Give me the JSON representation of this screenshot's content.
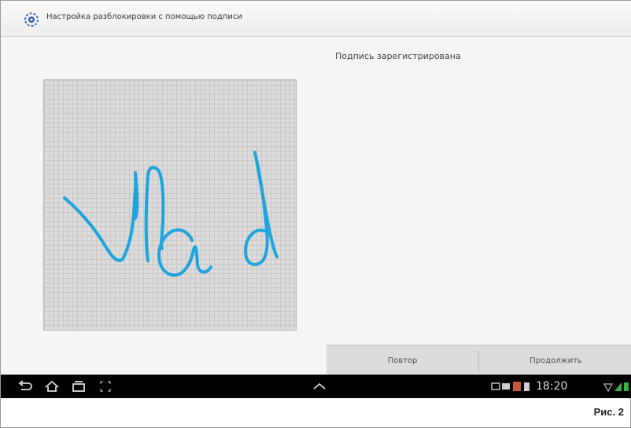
{
  "window": {
    "title": "Настройка разблокировки с помощью подписи",
    "app_icon": "gear-eye-icon"
  },
  "main": {
    "status_message": "Подпись зарегистрирована",
    "signature_handwriting": "Vlad"
  },
  "buttons": {
    "retry_label": "Повтор",
    "continue_label": "Продолжить"
  },
  "navbar": {
    "icons": [
      "back-icon",
      "home-icon",
      "recent-apps-icon",
      "screenshot-icon",
      "up-arrow-icon"
    ],
    "status_icons": [
      "gallery-icon",
      "email-icon",
      "no-sim-icon",
      "battery-small-icon",
      "wifi-icon",
      "signal-icon",
      "battery-icon"
    ],
    "time": "18:20"
  },
  "figure_label": "Рис. 2",
  "colors": {
    "ink": "#1fa4dc",
    "pad_background": "#dcdcdc",
    "nav_background": "#000000"
  }
}
